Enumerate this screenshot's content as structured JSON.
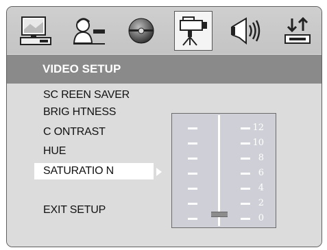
{
  "icon_bar": {
    "items": [
      {
        "icon": "general-setup-monitor-icon",
        "selected": false
      },
      {
        "icon": "language-setup-person-icon",
        "selected": false
      },
      {
        "icon": "audio-setup-disc-icon",
        "selected": false
      },
      {
        "icon": "video-setup-camera-icon",
        "selected": true
      },
      {
        "icon": "speaker-setup-icon",
        "selected": false
      },
      {
        "icon": "preference-setup-icon",
        "selected": false
      }
    ]
  },
  "header": {
    "title": "VIDEO SETUP"
  },
  "menu": {
    "items": [
      {
        "label": "SC REEN SAVER"
      },
      {
        "label": "BRIG HTNESS"
      },
      {
        "label": "C ONTRAST"
      },
      {
        "label": "HUE"
      },
      {
        "label": "SATURATIO N",
        "selected": true
      },
      {
        "label": "EXIT SETUP"
      }
    ]
  },
  "slider": {
    "labels": [
      "12",
      "10",
      "8",
      "6",
      "4",
      "2",
      "0"
    ],
    "current_value": 0
  },
  "colors": {
    "header_bg": "#8a8a8a",
    "panel_bg": "#dcdcdc",
    "slider_bg": "#cfd0d7"
  }
}
